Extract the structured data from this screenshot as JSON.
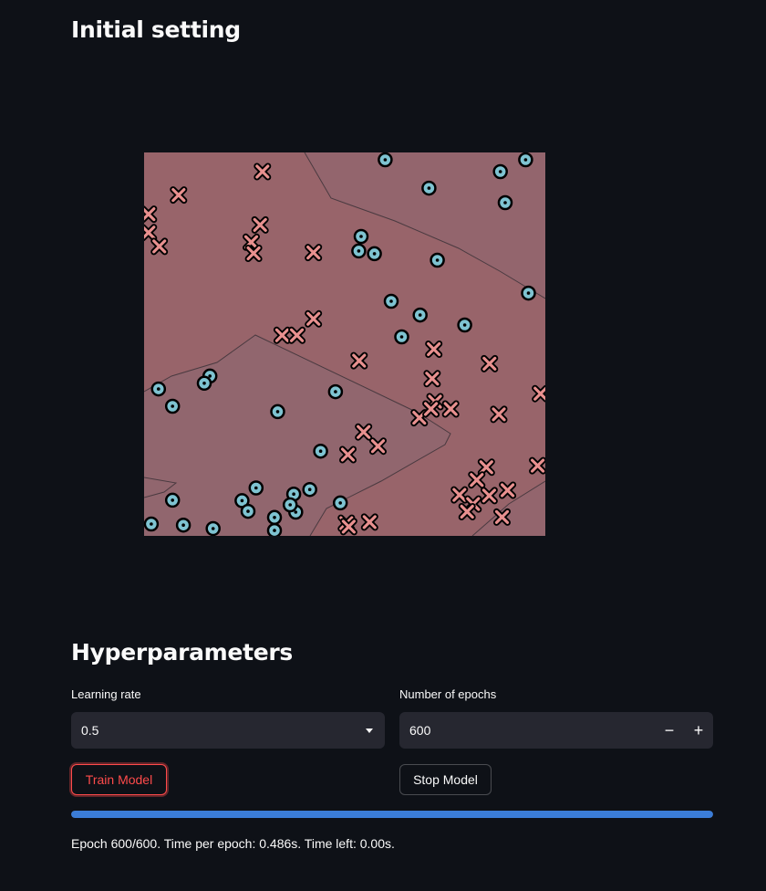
{
  "initial_setting": {
    "title": "Initial setting"
  },
  "chart_data": {
    "type": "scatter",
    "title": "",
    "xlabel": "",
    "ylabel": "",
    "xlim": [
      0,
      1
    ],
    "ylim": [
      0,
      1
    ],
    "grid": false,
    "background_color": "#98646a",
    "region_color": "#8e6670",
    "series": [
      {
        "marker": "x",
        "color": "#e8908f",
        "x": [
          0.295,
          0.086,
          0.011,
          0.011,
          0.038,
          0.289,
          0.267,
          0.273,
          0.422,
          0.422,
          0.344,
          0.381,
          0.536,
          0.722,
          0.861,
          0.988,
          0.718,
          0.725,
          0.764,
          0.686,
          0.715,
          0.884,
          0.547,
          0.583,
          0.508,
          0.853,
          0.829,
          0.981,
          0.786,
          0.86,
          0.906,
          0.82,
          0.892,
          0.805,
          0.504,
          0.562,
          0.51
        ],
        "y": [
          0.95,
          0.889,
          0.839,
          0.791,
          0.755,
          0.811,
          0.766,
          0.737,
          0.739,
          0.566,
          0.523,
          0.523,
          0.457,
          0.487,
          0.449,
          0.371,
          0.41,
          0.35,
          0.331,
          0.308,
          0.331,
          0.317,
          0.271,
          0.234,
          0.212,
          0.179,
          0.146,
          0.183,
          0.107,
          0.105,
          0.119,
          0.083,
          0.049,
          0.063,
          0.033,
          0.036,
          0.024
        ]
      },
      {
        "marker": "o",
        "color": "#7ec3d1",
        "x": [
          0.601,
          0.888,
          0.71,
          0.9,
          0.951,
          0.574,
          0.541,
          0.535,
          0.731,
          0.958,
          0.616,
          0.688,
          0.799,
          0.642,
          0.333,
          0.164,
          0.071,
          0.036,
          0.15,
          0.477,
          0.44,
          0.279,
          0.244,
          0.413,
          0.373,
          0.489,
          0.259,
          0.378,
          0.325,
          0.071,
          0.098,
          0.018,
          0.172,
          0.325,
          0.364
        ],
        "y": [
          0.981,
          0.95,
          0.907,
          0.869,
          0.981,
          0.736,
          0.781,
          0.743,
          0.719,
          0.633,
          0.612,
          0.576,
          0.55,
          0.519,
          0.324,
          0.417,
          0.338,
          0.383,
          0.398,
          0.376,
          0.221,
          0.125,
          0.092,
          0.121,
          0.109,
          0.086,
          0.064,
          0.062,
          0.048,
          0.093,
          0.028,
          0.031,
          0.019,
          0.014,
          0.081
        ]
      }
    ]
  },
  "hyperparameters": {
    "title": "Hyperparameters",
    "learning_rate": {
      "label": "Learning rate",
      "value": "0.5"
    },
    "epochs": {
      "label": "Number of epochs",
      "value": "600",
      "minus": "−",
      "plus": "+"
    },
    "train_button": "Train Model",
    "stop_button": "Stop Model",
    "progress": 1.0,
    "status": "Epoch 600/600. Time per epoch: 0.486s. Time left: 0.00s."
  },
  "colors": {
    "accent": "#ff4b4b",
    "progress": "#3b7dd8",
    "background": "#0e1117",
    "input": "#262730"
  }
}
